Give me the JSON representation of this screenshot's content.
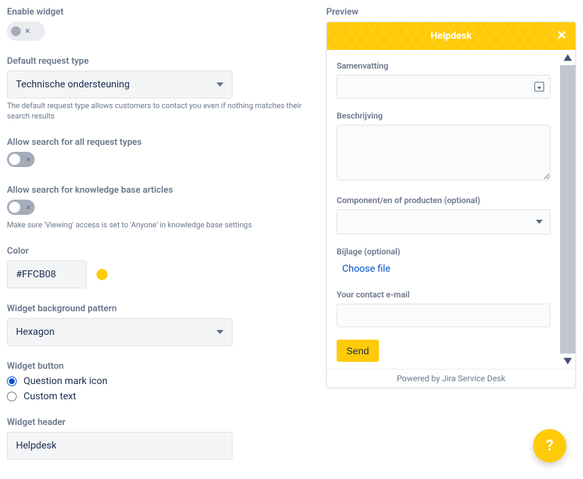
{
  "left": {
    "enable_widget": {
      "label": "Enable widget"
    },
    "default_request_type": {
      "label": "Default request type",
      "value": "Technische ondersteuning",
      "helper": "The default request type allows customers to contact you even if nothing matches their search results"
    },
    "allow_search_all": {
      "label": "Allow search for all request types"
    },
    "allow_search_kb": {
      "label": "Allow search for knowledge base articles",
      "helper": "Make sure 'Viewing' access is set to 'Anyone' in knowledge base settings"
    },
    "color": {
      "label": "Color",
      "value": "#FFCB08",
      "swatch": "#ffcb08"
    },
    "pattern": {
      "label": "Widget background pattern",
      "value": "Hexagon"
    },
    "widget_button": {
      "label": "Widget button",
      "options": [
        {
          "label": "Question mark icon",
          "checked": true
        },
        {
          "label": "Custom text",
          "checked": false
        }
      ]
    },
    "widget_header": {
      "label": "Widget header",
      "value": "Helpdesk"
    }
  },
  "preview": {
    "label": "Preview",
    "header_title": "Helpdesk",
    "accent": "#ffcb08",
    "fields": {
      "summary": "Samenvatting",
      "description": "Beschrijving",
      "component": "Component/en of producten (optional)",
      "attachment": "Bijlage (optional)",
      "choose_file": "Choose file",
      "contact": "Your contact e-mail",
      "send": "Send"
    },
    "footer": "Powered by Jira Service Desk"
  }
}
